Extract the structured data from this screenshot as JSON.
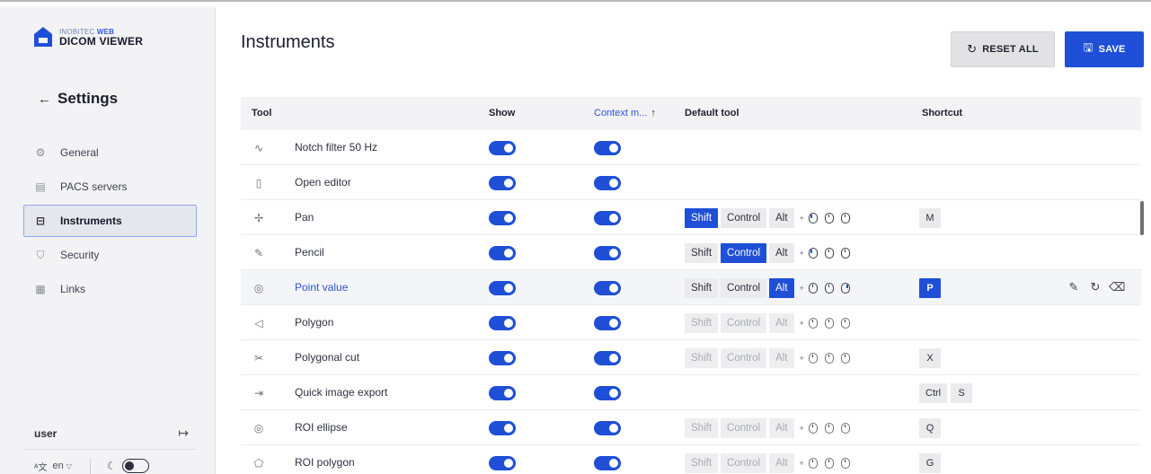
{
  "app": {
    "brand_prefix": "INOBITEC",
    "brand_web": "WEB",
    "product": "DICOM VIEWER"
  },
  "sidebar": {
    "back_icon": "arrow-left-icon",
    "title": "Settings",
    "items": [
      {
        "label": "General",
        "icon": "gear-icon",
        "active": false
      },
      {
        "label": "PACS servers",
        "icon": "server-icon",
        "active": false
      },
      {
        "label": "Instruments",
        "icon": "toolbox-icon",
        "active": true
      },
      {
        "label": "Security",
        "icon": "shield-icon",
        "active": false
      },
      {
        "label": "Links",
        "icon": "qr-icon",
        "active": false
      }
    ],
    "user": "user",
    "language": "en"
  },
  "header": {
    "title": "Instruments",
    "reset_label": "RESET ALL",
    "save_label": "SAVE"
  },
  "table": {
    "columns": {
      "tool": "Tool",
      "show": "Show",
      "context": "Context m...",
      "default_tool": "Default tool",
      "shortcut": "Shortcut"
    },
    "modifier_labels": {
      "shift": "Shift",
      "control": "Control",
      "alt": "Alt",
      "plus": "+"
    },
    "rows": [
      {
        "name": "Notch filter 50 Hz",
        "icon": "waveform-icon",
        "show": true,
        "context": true,
        "modifiers": null,
        "shortcut": []
      },
      {
        "name": "Open editor",
        "icon": "document-icon",
        "show": true,
        "context": true,
        "modifiers": null,
        "shortcut": []
      },
      {
        "name": "Pan",
        "icon": "move-icon",
        "show": true,
        "context": true,
        "modifiers": {
          "shift": "on",
          "control": "off",
          "alt": "off",
          "mouse": "left"
        },
        "shortcut": [
          "M"
        ]
      },
      {
        "name": "Pencil",
        "icon": "pencil-icon",
        "show": true,
        "context": true,
        "modifiers": {
          "shift": "off",
          "control": "on",
          "alt": "off",
          "mouse": "left"
        },
        "shortcut": []
      },
      {
        "name": "Point value",
        "icon": "target-icon",
        "show": true,
        "context": true,
        "modifiers": {
          "shift": "off",
          "control": "off",
          "alt": "on",
          "mouse": "right"
        },
        "shortcut": [
          "P"
        ],
        "selected": true
      },
      {
        "name": "Polygon",
        "icon": "polygon-icon",
        "show": true,
        "context": true,
        "modifiers": {
          "shift": "dis",
          "control": "dis",
          "alt": "dis",
          "mouse": "none"
        },
        "shortcut": []
      },
      {
        "name": "Polygonal cut",
        "icon": "scissors-icon",
        "show": true,
        "context": true,
        "modifiers": {
          "shift": "dis",
          "control": "dis",
          "alt": "dis",
          "mouse": "none"
        },
        "shortcut": [
          "X"
        ]
      },
      {
        "name": "Quick image export",
        "icon": "export-icon",
        "show": true,
        "context": true,
        "modifiers": null,
        "shortcut": [
          "Ctrl",
          "S"
        ]
      },
      {
        "name": "ROI ellipse",
        "icon": "ellipse-icon",
        "show": true,
        "context": true,
        "modifiers": {
          "shift": "dis",
          "control": "dis",
          "alt": "dis",
          "mouse": "none"
        },
        "shortcut": [
          "Q"
        ]
      },
      {
        "name": "ROI polygon",
        "icon": "roi-polygon-icon",
        "show": true,
        "context": true,
        "modifiers": {
          "shift": "dis",
          "control": "dis",
          "alt": "dis",
          "mouse": "none"
        },
        "shortcut": [
          "G"
        ]
      }
    ]
  },
  "colors": {
    "accent": "#1e4fd6",
    "selected_text": "#2d55cf"
  }
}
